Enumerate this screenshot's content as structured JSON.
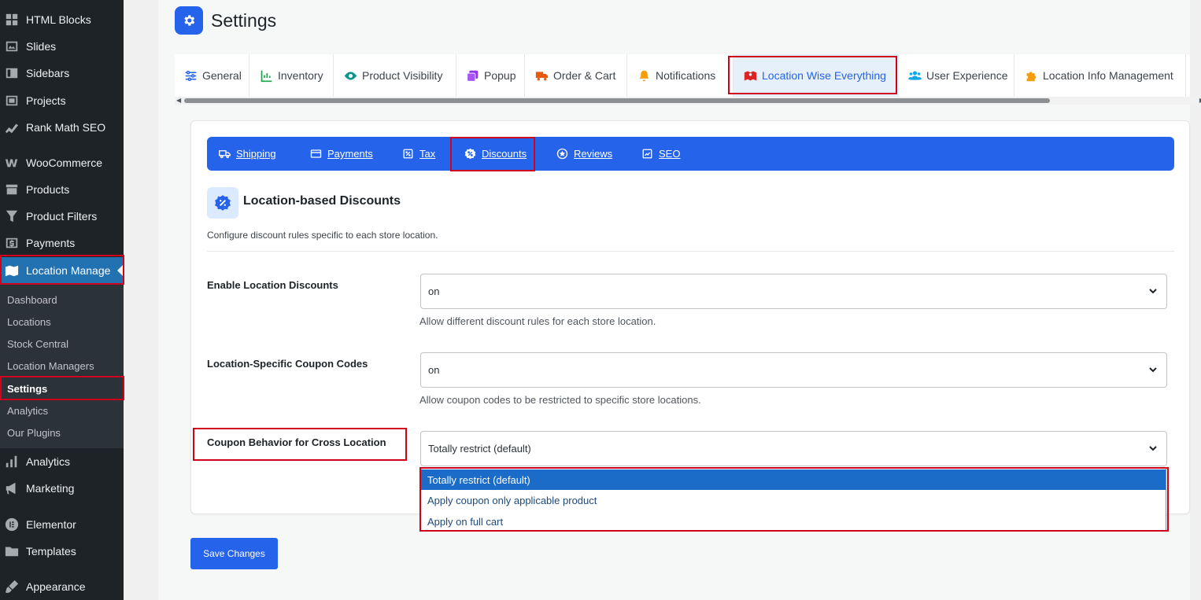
{
  "sidebar": {
    "items": [
      {
        "label": "HTML Blocks",
        "icon": "grid-icon"
      },
      {
        "label": "Slides",
        "icon": "slides-icon"
      },
      {
        "label": "Sidebars",
        "icon": "sidebars-icon"
      },
      {
        "label": "Projects",
        "icon": "projects-icon"
      },
      {
        "label": "Rank Math SEO",
        "icon": "chart-icon"
      },
      {
        "label": "WooCommerce",
        "icon": "woo-icon"
      },
      {
        "label": "Products",
        "icon": "archive-icon"
      },
      {
        "label": "Product Filters",
        "icon": "filter-icon"
      },
      {
        "label": "Payments",
        "icon": "dollar-icon"
      },
      {
        "label": "Location Manage",
        "icon": "map-icon"
      },
      {
        "label": "Analytics",
        "icon": "bar-chart-icon"
      },
      {
        "label": "Marketing",
        "icon": "megaphone-icon"
      },
      {
        "label": "Elementor",
        "icon": "elementor-icon"
      },
      {
        "label": "Templates",
        "icon": "folder-icon"
      },
      {
        "label": "Appearance",
        "icon": "brush-icon"
      }
    ],
    "submenu": [
      "Dashboard",
      "Locations",
      "Stock Central",
      "Location Managers",
      "Settings",
      "Analytics",
      "Our Plugins"
    ]
  },
  "page": {
    "title": "Settings"
  },
  "tabs": [
    {
      "label": "General",
      "icon": "sliders-icon"
    },
    {
      "label": "Inventory",
      "icon": "inventory-chart-icon"
    },
    {
      "label": "Product Visibility",
      "icon": "eye-icon"
    },
    {
      "label": "Popup",
      "icon": "popup-icon"
    },
    {
      "label": "Order & Cart",
      "icon": "truck-icon"
    },
    {
      "label": "Notifications",
      "icon": "bell-icon"
    },
    {
      "label": "Location Wise Everything",
      "icon": "map-marker-icon"
    },
    {
      "label": "User Experience",
      "icon": "users-icon"
    },
    {
      "label": "Location Info Management",
      "icon": "puzzle-icon"
    }
  ],
  "subnav": [
    {
      "label": "Shipping",
      "icon": "shipping-icon"
    },
    {
      "label": "Payments",
      "icon": "card-icon"
    },
    {
      "label": "Tax",
      "icon": "tax-icon"
    },
    {
      "label": "Discounts",
      "icon": "discount-icon"
    },
    {
      "label": "Reviews",
      "icon": "star-icon"
    },
    {
      "label": "SEO",
      "icon": "seo-icon"
    }
  ],
  "section": {
    "title": "Location-based Discounts",
    "description": "Configure discount rules specific to each store location."
  },
  "fields": [
    {
      "label": "Enable Location Discounts",
      "value": "on",
      "help": "Allow different discount rules for each store location."
    },
    {
      "label": "Location-Specific Coupon Codes",
      "value": "on",
      "help": "Allow coupon codes to be restricted to specific store locations."
    },
    {
      "label": "Coupon Behavior for Cross Location",
      "value": "Totally restrict (default)",
      "help": ""
    }
  ],
  "dropdown": {
    "options": [
      "Totally restrict (default)",
      "Apply coupon only applicable product",
      "Apply on full cart"
    ]
  },
  "buttons": {
    "save": "Save Changes"
  },
  "colors": {
    "accent": "#2563eb",
    "sidebar": "#1d2327",
    "highlight": "#d0021b"
  }
}
